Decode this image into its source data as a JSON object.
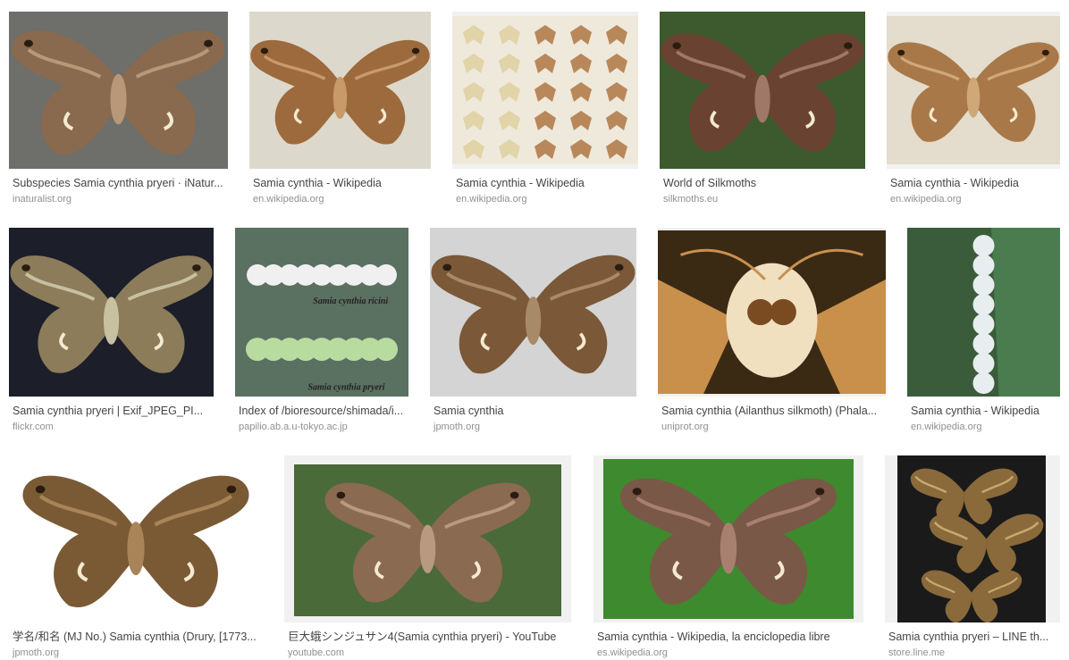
{
  "results": [
    {
      "title": "Subspecies Samia cynthia pryeri · iNatur...",
      "source": "inaturalist.org",
      "image": "moth-on-asphalt",
      "bg": "#6e6e6a",
      "wing": "#8a6a4e",
      "wing2": "#b89878"
    },
    {
      "title": "Samia cynthia - Wikipedia",
      "source": "en.wikipedia.org",
      "image": "pinned-moth-specimen",
      "bg": "#ddd8cc",
      "wing": "#9c6a3c",
      "wing2": "#c89a6a"
    },
    {
      "title": "Samia cynthia - Wikipedia",
      "source": "en.wikipedia.org",
      "image": "specimen-collection-box",
      "bg": "#efe9dc",
      "wing": "#b8885a",
      "wing2": "#e0d4a8"
    },
    {
      "title": "World of Silkmoths",
      "source": "silkmoths.eu",
      "image": "moth-on-branch",
      "bg": "#3c5a2e",
      "wing": "#6a4232",
      "wing2": "#a07868"
    },
    {
      "title": "Samia cynthia - Wikipedia",
      "source": "en.wikipedia.org",
      "image": "pinned-moth-specimen",
      "bg": "#e4dccc",
      "wing": "#a87848",
      "wing2": "#d0a878"
    },
    {
      "title": "Samia cynthia pryeri | Exif_JPEG_PI...",
      "source": "flickr.com",
      "image": "moth-at-night",
      "bg": "#1c1e2a",
      "wing": "#8c7c5a",
      "wing2": "#c8c0a0"
    },
    {
      "title": "Index of /bioresource/shimada/i...",
      "source": "papilio.ab.a.u-tokyo.ac.jp",
      "image": "silkworm-caterpillars",
      "bg": "#5a7060",
      "wing": "#f0f0f0",
      "wing2": "#b8dca0",
      "caption1": "Samia cynthia ricini",
      "caption2": "Samia cynthia pryeri"
    },
    {
      "title": "Samia cynthia",
      "source": "jpmoth.org",
      "image": "moth-specimen-on-grey",
      "bg": "#d4d4d4",
      "wing": "#7a5838",
      "wing2": "#a88a68"
    },
    {
      "title": "Samia cynthia (Ailanthus silkmoth) (Phala...",
      "source": "uniprot.org",
      "image": "moth-face-closeup",
      "bg": "#3a2a14",
      "wing": "#c8904a",
      "wing2": "#f0e0c0"
    },
    {
      "title": "Samia cynthia - Wikipedia",
      "source": "en.wikipedia.org",
      "image": "caterpillar-on-leaf",
      "bg": "#3a5c3a",
      "wing": "#e8eef0",
      "wing2": "#4a7c50"
    },
    {
      "title": "学名/和名 (MJ No.) Samia cynthia (Drury, [1773...",
      "source": "jpmoth.org",
      "image": "moth-specimen-on-white",
      "bg": "#ffffff",
      "wing": "#7a5a34",
      "wing2": "#a88458"
    },
    {
      "title": "巨大蛾シンジュサン4(Samia cynthia pryeri) - YouTube",
      "source": "youtube.com",
      "image": "moth-in-garden",
      "bg": "#4a6a3a",
      "wing": "#8a6a50",
      "wing2": "#b89a80"
    },
    {
      "title": "Samia cynthia - Wikipedia, la enciclopedia libre",
      "source": "es.wikipedia.org",
      "image": "moth-on-stem",
      "bg": "#3e8a2e",
      "wing": "#7a5848",
      "wing2": "#a88070"
    },
    {
      "title": "Samia cynthia pryeri – LINE th...",
      "source": "store.line.me",
      "image": "moth-illustrations",
      "bg": "#1a1a1a",
      "wing": "#8a6a3a",
      "wing2": "#c8a870"
    }
  ]
}
